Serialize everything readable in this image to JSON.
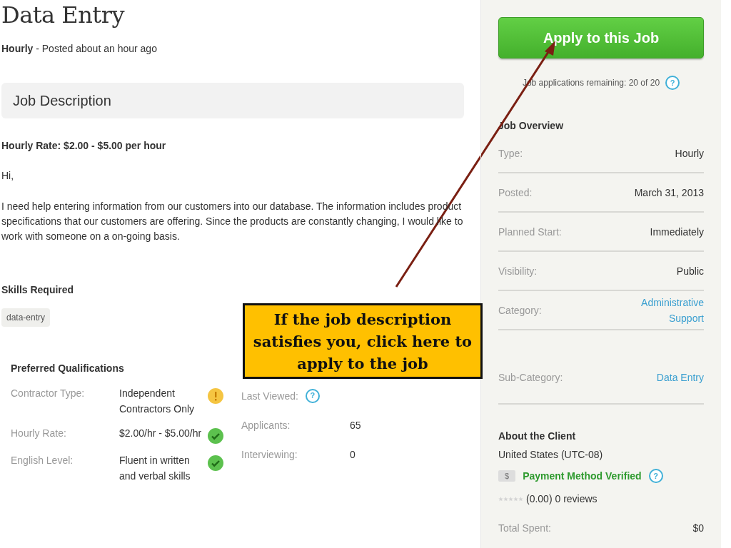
{
  "title": "Data Entry",
  "subtitle": {
    "type": "Hourly",
    "posted": "- Posted about an hour ago"
  },
  "section_title": "Job Description",
  "rate": "Hourly Rate: $2.00 - $5.00 per hour",
  "greeting": "Hi,",
  "description": "I need help entering information from our customers into our database. The information includes product specifications that our customers are offering. Since the products are constantly changing, I would like to work with someone on a on-going basis.",
  "skills": {
    "title": "Skills Required",
    "tags": [
      "data-entry"
    ]
  },
  "qualifications": {
    "title": "Preferred Qualifications",
    "rows": [
      {
        "label": "Contractor Type:",
        "value": "Independent Contractors Only",
        "kind": "warning"
      },
      {
        "label": "Hourly Rate:",
        "value": "$2.00/hr - $5.00/hr",
        "kind": "check"
      },
      {
        "label": "English Level:",
        "value": "Fluent in written and verbal skills",
        "kind": "check"
      }
    ]
  },
  "activity": [
    {
      "label": "Last Viewed:",
      "kind": "help",
      "icon": "?"
    },
    {
      "label": "Applicants:",
      "value": "65",
      "kind": "value"
    },
    {
      "label": "Interviewing:",
      "value": "0",
      "kind": "value"
    }
  ],
  "callout": "If the job description satisfies you, click here to apply to the job",
  "sidebar": {
    "apply_button": "Apply to this Job",
    "remaining": "Job applications remaining: 20 of 20",
    "remaining_help": "?",
    "overview_title": "Job Overview",
    "overview": [
      {
        "label": "Type:",
        "value": "Hourly",
        "link": false
      },
      {
        "label": "Posted:",
        "value": "March 31, 2013",
        "link": false
      },
      {
        "label": "Planned Start:",
        "value": "Immediately",
        "link": false
      },
      {
        "label": "Visibility:",
        "value": "Public",
        "link": false
      },
      {
        "label": "Category:",
        "value": "Administrative Support",
        "link": true
      },
      {
        "label": "Sub-Category:",
        "value": "Data Entry",
        "link": true
      }
    ],
    "client": {
      "title": "About the Client",
      "location": "United States (UTC-08)",
      "payment_badge": "$",
      "payment": "Payment Method Verified",
      "payment_help": "?",
      "stars": 0,
      "reviews": "(0.00) 0 reviews",
      "total_label": "Total Spent:",
      "total_value": "$0"
    }
  }
}
